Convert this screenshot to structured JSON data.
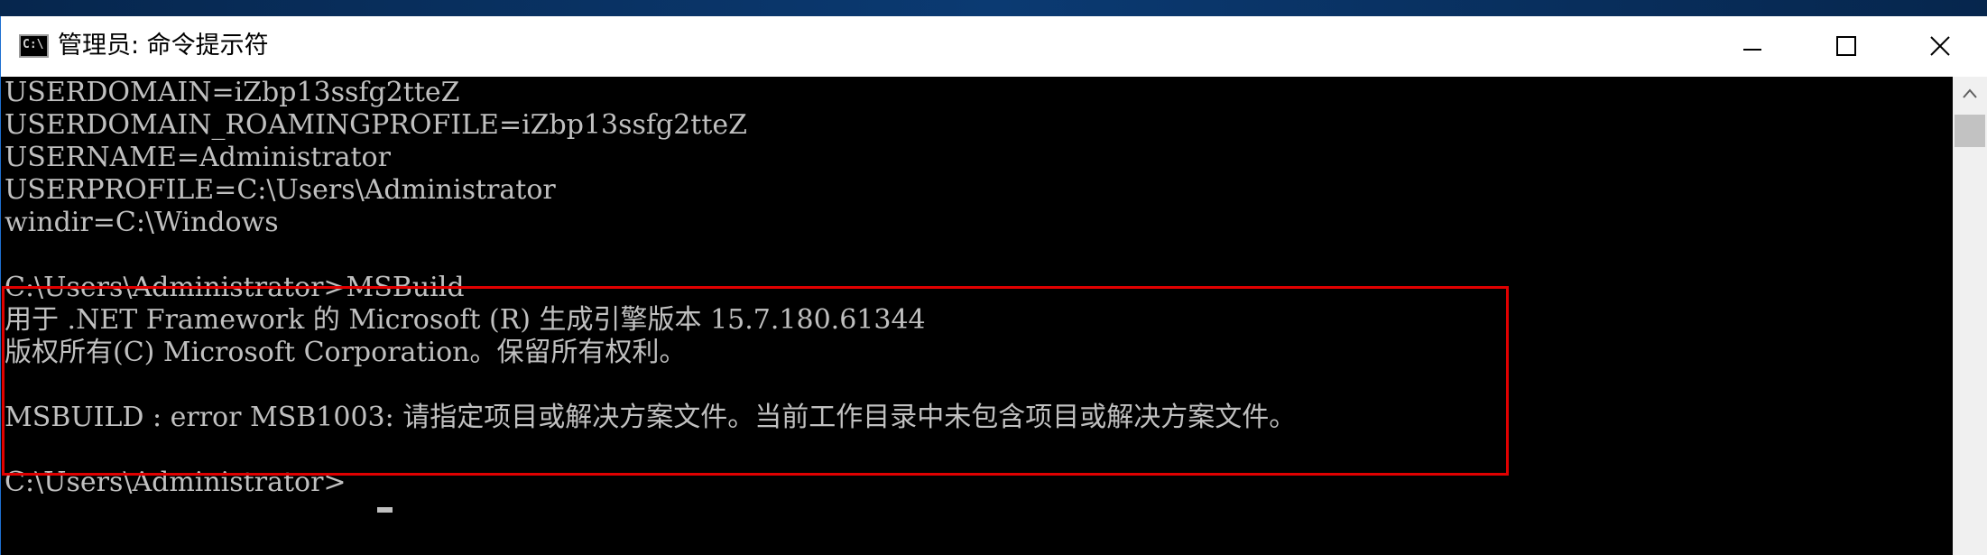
{
  "window": {
    "title": "管理员: 命令提示符",
    "icon": "cmd-console-icon",
    "icon_glyph": "C:\\",
    "accent_border": "#1e6fd0"
  },
  "caption_buttons": {
    "minimize_icon": "minimize-icon",
    "maximize_icon": "maximize-icon",
    "close_icon": "close-icon"
  },
  "console": {
    "text_color": "#c0c0c0",
    "background": "#000000",
    "lines": [
      "USERDOMAIN=iZbp13ssfg2tteZ",
      "USERDOMAIN_ROAMINGPROFILE=iZbp13ssfg2tteZ",
      "USERNAME=Administrator",
      "USERPROFILE=C:\\Users\\Administrator",
      "windir=C:\\Windows",
      "",
      "C:\\Users\\Administrator>MSBuild",
      "用于 .NET Framework 的 Microsoft (R) 生成引擎版本 15.7.180.61344",
      "版权所有(C) Microsoft Corporation。保留所有权利。",
      "",
      "MSBUILD : error MSB1003: 请指定项目或解决方案文件。当前工作目录中未包含项目或解决方案文件。",
      "",
      "C:\\Users\\Administrator>"
    ],
    "highlight_color": "#e00000"
  },
  "scrollbar": {
    "up_icon": "scroll-up-arrow-icon"
  }
}
